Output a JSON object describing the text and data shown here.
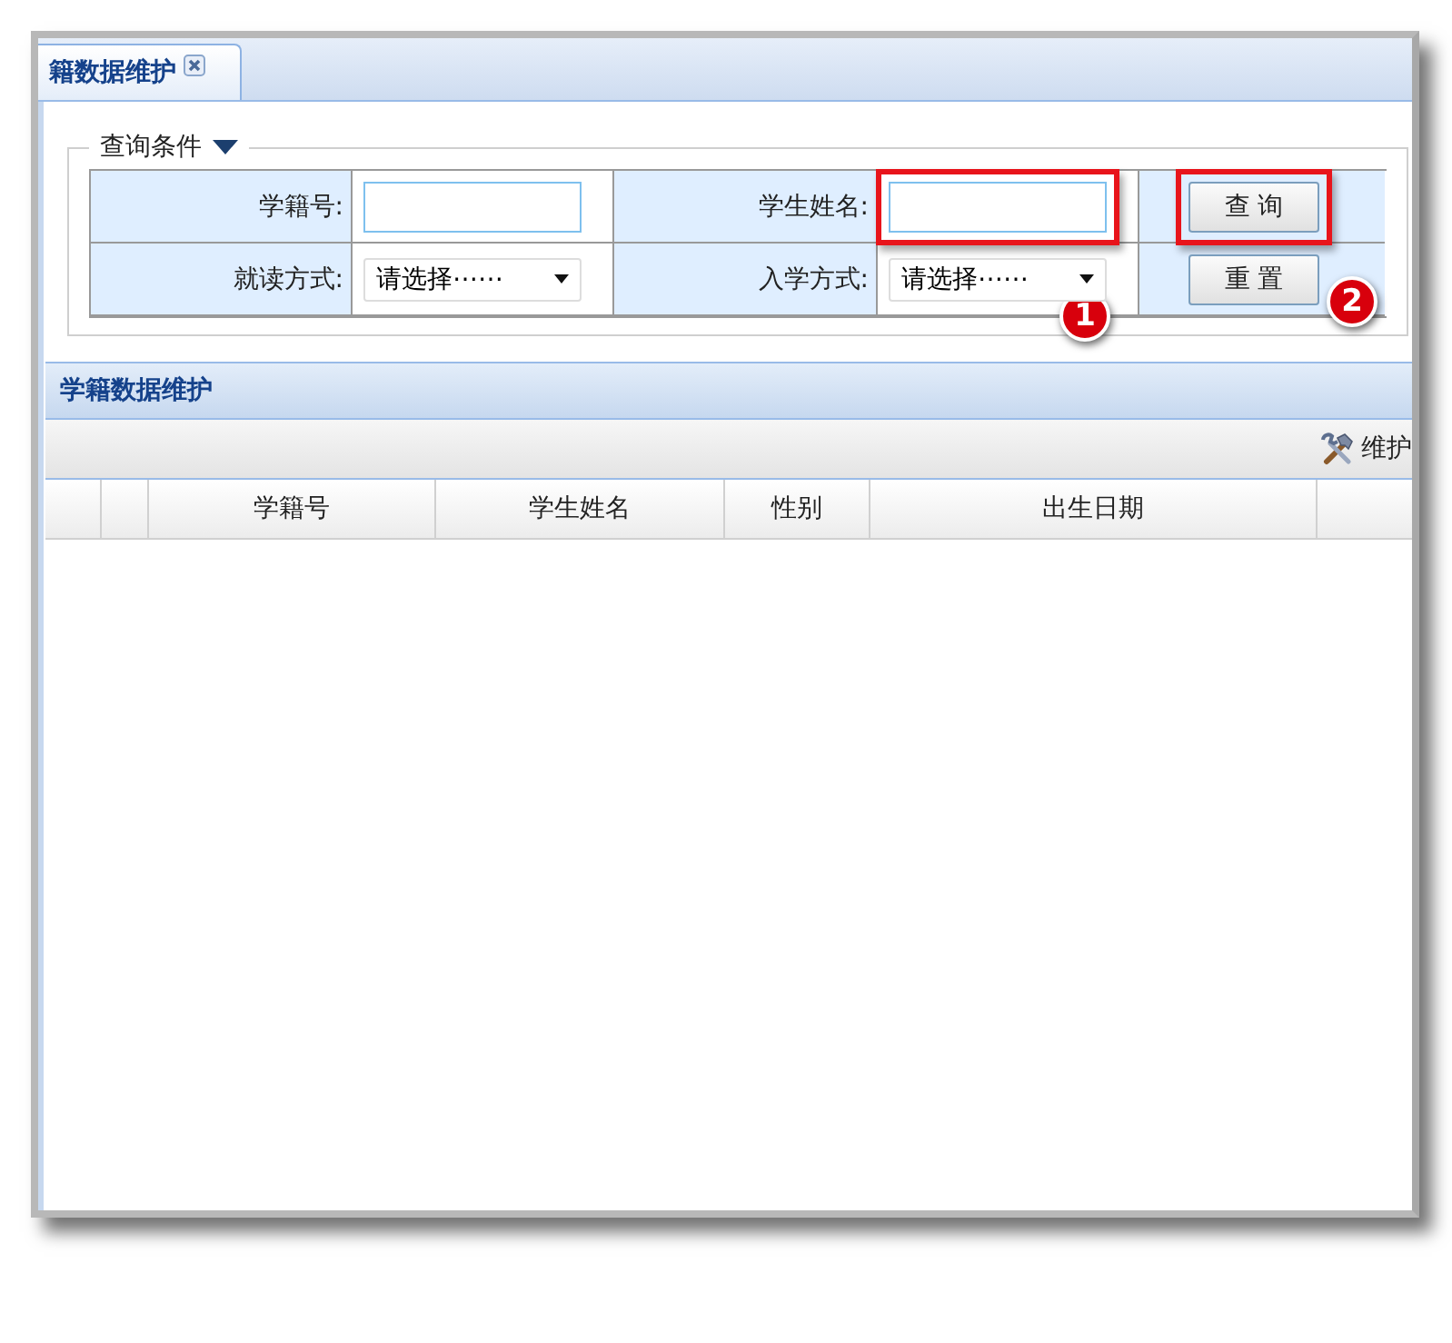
{
  "tab": {
    "title": "籍数据维护",
    "selected": true
  },
  "query": {
    "legend": "查询条件",
    "expanded": true,
    "fields": [
      {
        "label": "学籍号:",
        "kind": "text",
        "highlighted": false
      },
      {
        "label": "学生姓名:",
        "kind": "text",
        "highlighted": true
      },
      {
        "label": "就读方式:",
        "kind": "select",
        "value": "请选择⋯⋯",
        "highlighted": false
      },
      {
        "label": "入学方式:",
        "kind": "select",
        "value": "请选择⋯⋯",
        "highlighted": false,
        "callout": "1"
      }
    ],
    "buttons": [
      {
        "label": "查 询",
        "highlighted": true
      },
      {
        "label": "重 置",
        "highlighted": false,
        "callout": "2"
      }
    ]
  },
  "grid": {
    "title": "学籍数据维护",
    "toolbar_button": "维护",
    "columns": [
      {
        "kind": "spacer"
      },
      {
        "kind": "spacer"
      },
      {
        "kind": "text",
        "label": "学籍号"
      },
      {
        "kind": "text",
        "label": "学生姓名"
      },
      {
        "kind": "text",
        "label": "性别"
      },
      {
        "kind": "text",
        "label": "出生日期"
      },
      {
        "kind": "spacer"
      }
    ]
  }
}
